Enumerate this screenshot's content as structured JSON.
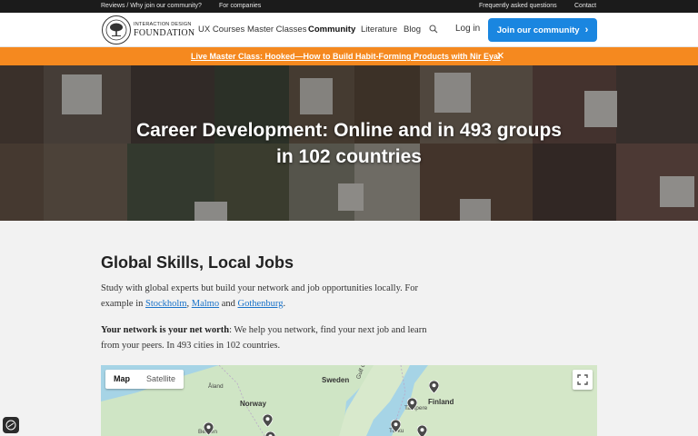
{
  "topbar": {
    "reviews": "Reviews / Why join our community?",
    "companies": "For companies",
    "faq": "Frequently asked questions",
    "contact": "Contact"
  },
  "logo": {
    "line1": "INTERACTION DESIGN",
    "line2": "FOUNDATION"
  },
  "nav": {
    "items": [
      "UX Courses",
      "Master Classes",
      "Community",
      "Literature",
      "Blog"
    ],
    "active": "Community",
    "login": "Log in",
    "join": "Join our community"
  },
  "banner": {
    "text": "Live Master Class: Hooked—How to Build Habit-Forming Products with Nir Eyal",
    "close_icon": "close-icon",
    "color": "#f5891f"
  },
  "hero": {
    "line1": "Career Development: Online and in 493 groups",
    "line2": "in 102 countries"
  },
  "content": {
    "title": "Global Skills, Local Jobs",
    "p1_text": "Study with global experts but build your network and job opportunities locally. For example in ",
    "city1": "Stockholm",
    "sep1": ", ",
    "city2": "Malmo",
    "sep2": " and ",
    "city3": "Gothenburg",
    "p1_end": ".",
    "p2_bold": "Your network is your net worth",
    "p2_text": ": We help you network, find your next job and learn from your peers. In 493 cities in 102 countries."
  },
  "map": {
    "tab_map": "Map",
    "tab_satellite": "Satellite",
    "labels": {
      "sweden": "Sweden",
      "norway": "Norway",
      "finland": "Finland",
      "tampere": "Tampere",
      "aland": "Åland",
      "gulf": "Gulf of Bothnia",
      "bergen": "Bergen",
      "turku": "Turku"
    }
  },
  "colors": {
    "accent": "#1a86e0",
    "banner": "#f5891f",
    "link": "#1a73c9"
  }
}
